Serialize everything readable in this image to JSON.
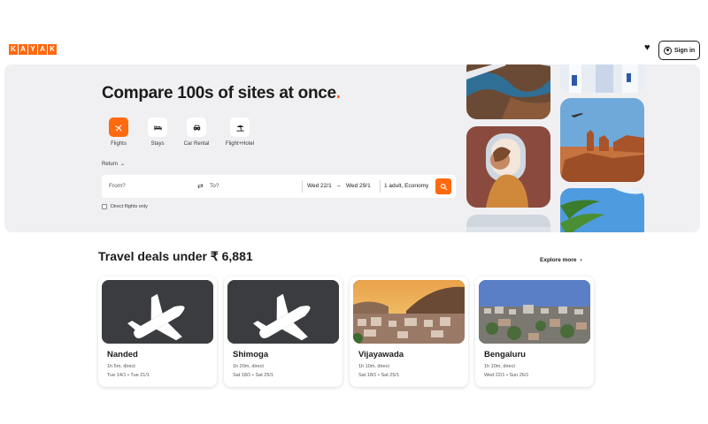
{
  "brand": {
    "logo_letters": [
      "K",
      "A",
      "Y",
      "A",
      "K"
    ],
    "accent": "#ff690f"
  },
  "header": {
    "signin_label": "Sign in"
  },
  "hero": {
    "headline": "Compare 100s of sites at once",
    "headline_dot": ".",
    "modes": [
      {
        "label": "Flights",
        "icon": "plane-icon",
        "active": true
      },
      {
        "label": "Stays",
        "icon": "bed-icon",
        "active": false
      },
      {
        "label": "Car Rental",
        "icon": "car-icon",
        "active": false
      },
      {
        "label": "Flight+Hotel",
        "icon": "beach-icon",
        "active": false
      }
    ],
    "trip_type": "Return",
    "search": {
      "from_placeholder": "From?",
      "to_placeholder": "To?",
      "depart": "Wed 22/1",
      "return": "Wed 29/1",
      "travellers": "1 adult, Economy"
    },
    "direct_only_label": "Direct flights only"
  },
  "deals": {
    "title": "Travel deals under ₹ 6,881",
    "explore_label": "Explore more",
    "cards": [
      {
        "city": "Nanded",
        "duration": "1h 5m, direct",
        "depart": "Tue 14/1",
        "return": "Tue 21/1",
        "image": "placeholder"
      },
      {
        "city": "Shimoga",
        "duration": "1h 20m, direct",
        "depart": "Sat 18/1",
        "return": "Sat 25/1",
        "image": "placeholder"
      },
      {
        "city": "Vijayawada",
        "duration": "1h 10m, direct",
        "depart": "Sat 18/1",
        "return": "Sat 25/1",
        "image": "photo"
      },
      {
        "city": "Bengaluru",
        "duration": "1h 10m, direct",
        "depart": "Wed 22/1",
        "return": "Sun 26/1",
        "image": "photo"
      }
    ]
  }
}
